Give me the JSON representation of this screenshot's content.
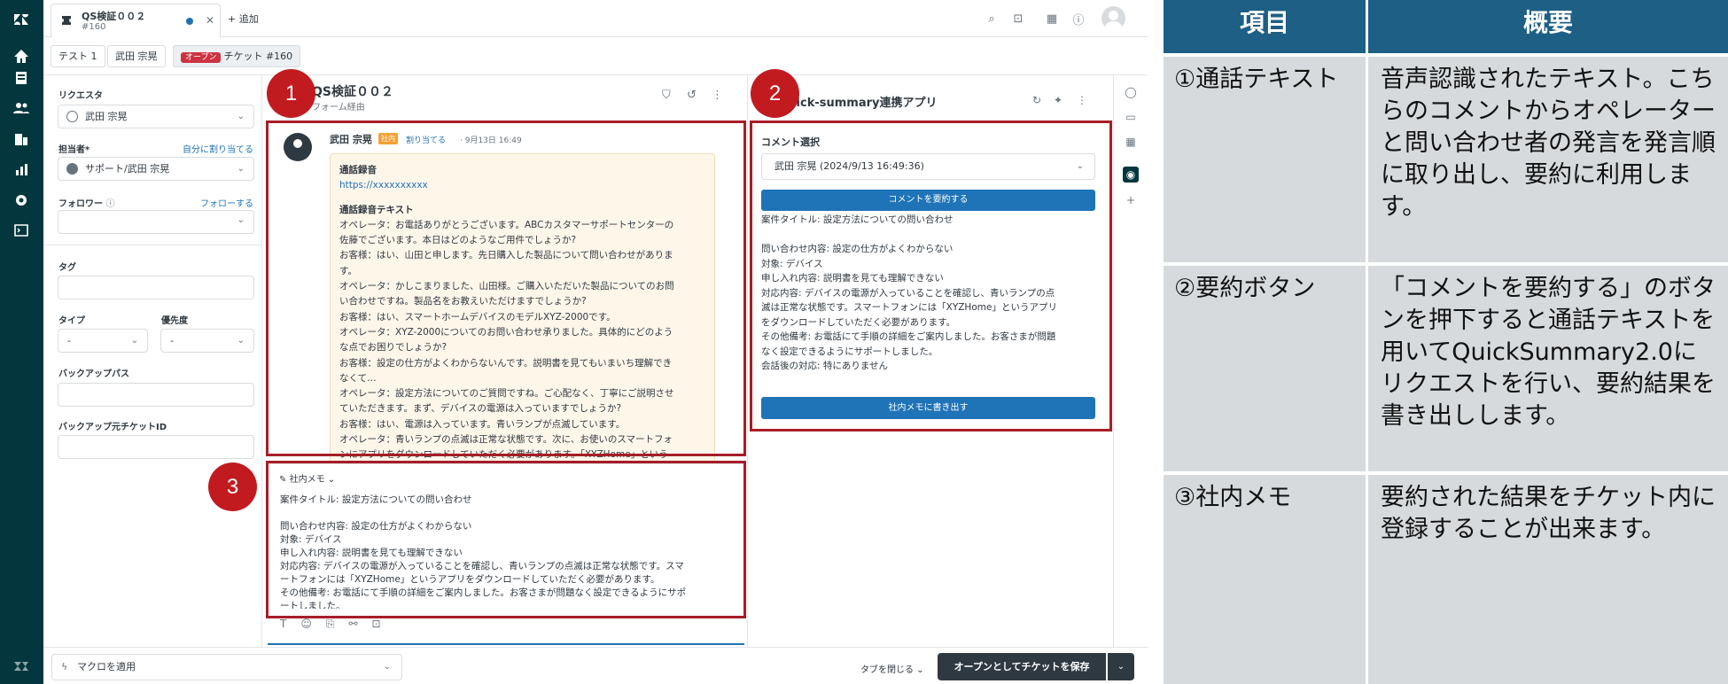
{
  "tab": {
    "title": "QS検証００２",
    "subtitle": "#160",
    "add": "+ 追加"
  },
  "crumbs": {
    "org": "テスト 1",
    "user": "武田 宗晃",
    "status": "オープン",
    "ticket": "チケット #160"
  },
  "left": {
    "requester_label": "リクエスタ",
    "requester": "武田 宗晃",
    "assignee_label": "担当者*",
    "assign_self": "自分に割り当てる",
    "assignee": "サポート/武田 宗晃",
    "follower_label": "フォロワー",
    "follow": "フォローする",
    "tags_label": "タグ",
    "type_label": "タイプ",
    "type_value": "-",
    "priority_label": "優先度",
    "priority_value": "-",
    "backup_path_label": "バックアップパス",
    "backup_id_label": "バックアップ元チケットID"
  },
  "conversation": {
    "title": "QS検証００２",
    "via": "フォーム経由",
    "author": "武田 宗晃",
    "internal_badge": "社内",
    "assign_link": "割り当てる",
    "date": "· 9月13日 16:49",
    "rec_heading": "通話録音",
    "rec_url": "https://xxxxxxxxxx",
    "text_heading": "通話録音テキスト",
    "lines": [
      "オペレータ：お電話ありがとうございます。ABCカスタマーサポートセンターの",
      "佐藤でございます。本日はどのようなご用件でしょうか?",
      "お客様：はい、山田と申します。先日購入した製品について問い合わせがありま",
      "す。",
      "オペレータ：かしこまりました、山田様。ご購入いただいた製品についてのお問",
      "い合わせですね。製品名をお教えいただけますでしょうか?",
      "お客様：はい、スマートホームデバイスのモデルXYZ-2000です。",
      "オペレータ：XYZ-2000についてのお問い合わせ承りました。具体的にどのよう",
      "な点でお困りでしょうか?",
      "お客様：設定の仕方がよくわからないんです。説明書を見てもいまいち理解でき",
      "なくて…",
      "オペレータ：設定方法についてのご質問ですね。ご心配なく、丁寧にご説明させ",
      "ていただきます。まず、デバイスの電源は入っていますでしょうか?",
      "お客様：はい、電源は入っています。青いランプが点滅しています。",
      "オペレータ：青いランプの点滅は正常な状態です。次に、お使いのスマートフォ",
      "ンにアプリをダウンロードしていただく必要があります。「XYZHome」という"
    ]
  },
  "composer": {
    "type_label": "社内メモ",
    "body": "案件タイトル: 設定方法についての問い合わせ\n\n問い合わせ内容: 設定の仕方がよくわからない\n対象: デバイス\n申し入れ内容: 説明書を見ても理解できない\n対応内容: デバイスの電源が入っていることを確認し、青いランプの点滅は正常な状態です。スマ\nートフォンには「XYZHome」というアプリをダウンロードしていただく必要があります。\nその他備考: お電話にて手順の詳細をご案内しました。お客さまが問題なく設定できるようにサポ\nートしました。\n会話後の対応: 特にありません"
  },
  "app": {
    "title": "quick-summary連携アプリ",
    "comment_label": "コメント選択",
    "comment_value": "武田 宗晃 (2024/9/13 16:49:36)",
    "summarize_button": "コメントを要約する",
    "summary": "案件タイトル: 設定方法についての問い合わせ\n\n問い合わせ内容: 設定の仕方がよくわからない\n対象: デバイス\n申し入れ内容: 説明書を見ても理解できない\n対応内容: デバイスの電源が入っていることを確認し、青いランプの点\n滅は正常な状態です。スマートフォンには「XYZHome」というアプリ\nをダウンロードしていただく必要があります。\nその他備考: お電話にて手順の詳細をご案内しました。お客さまが問題\nなく設定できるようにサポートしました。\n会話後の対応: 特にありません",
    "write_button": "社内メモに書き出す"
  },
  "footer": {
    "macro": "マクロを適用",
    "close_tab": "タブを閉じる",
    "save": "オープンとしてチケットを保存"
  },
  "markers": [
    "1",
    "2",
    "3"
  ],
  "table": {
    "headers": [
      "項目",
      "概要"
    ],
    "rows": [
      {
        "item": "①通話テキスト",
        "desc": "音声認識されたテキスト。こちらのコメントからオペレーターと問い合わせ者の発言を発言順に取り出し、要約に利用します。"
      },
      {
        "item": "②要約ボタン",
        "desc": "「コメントを要約する」のボタンを押下すると通話テキストを用いてQuickSummary2.0にリクエストを行い、要約結果を書き出しします。"
      },
      {
        "item": "③社内メモ",
        "desc": "要約された結果をチケット内に登録することが出来ます。"
      }
    ]
  },
  "colors": {
    "nav": "#03363d",
    "accent": "#1f73b7",
    "marker": "#c11b20",
    "table_header": "#1d5f85",
    "table_cell": "#d6dadd"
  }
}
